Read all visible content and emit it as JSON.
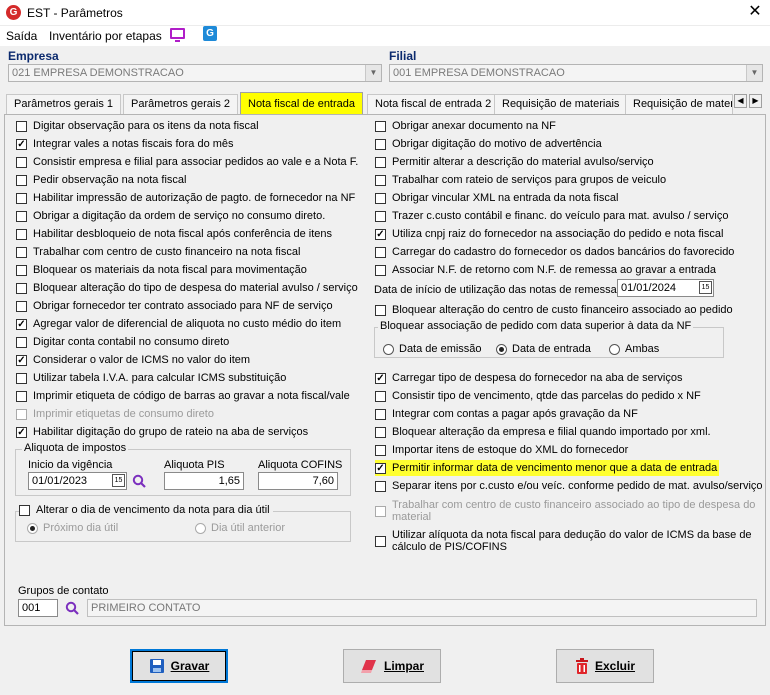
{
  "window": {
    "title": "EST - Parâmetros",
    "close": "✕"
  },
  "menu": {
    "items": [
      "Saída",
      "Inventário por etapas"
    ]
  },
  "empresa": {
    "label": "Empresa",
    "value": "021 EMPRESA DEMONSTRACAO"
  },
  "filial": {
    "label": "Filial",
    "value": "001 EMPRESA DEMONSTRACAO"
  },
  "tabs": [
    "Parâmetros gerais 1",
    "Parâmetros gerais 2",
    "Nota fiscal de entrada",
    "Nota fiscal de entrada 2",
    "Requisição de materiais",
    "Requisição de materi"
  ],
  "active_tab": "Nota fiscal de entrada",
  "left_options": [
    {
      "label": "Digitar observação para os itens da nota fiscal",
      "checked": false
    },
    {
      "label": "Integrar vales a notas fiscais fora do mês",
      "checked": true
    },
    {
      "label": "Consistir empresa e filial para associar pedidos ao vale e a Nota F.",
      "checked": false
    },
    {
      "label": "Pedir observação na nota fiscal",
      "checked": false
    },
    {
      "label": "Habilitar impressão de autorização de pagto. de fornecedor na NF",
      "checked": false
    },
    {
      "label": "Obrigar a digitação da ordem de serviço no consumo direto.",
      "checked": false
    },
    {
      "label": "Habilitar desbloqueio de nota fiscal após conferência de itens",
      "checked": false
    },
    {
      "label": "Trabalhar com centro de custo financeiro na nota fiscal",
      "checked": false
    },
    {
      "label": "Bloquear os materiais da nota fiscal para movimentação",
      "checked": false
    },
    {
      "label": "Bloquear alteração do tipo de despesa do material avulso / serviço",
      "checked": false
    },
    {
      "label": "Obrigar fornecedor ter contrato associado para NF de serviço",
      "checked": false
    },
    {
      "label": "Agregar valor de diferencial de aliquota no custo médio do item",
      "checked": true
    },
    {
      "label": "Digitar conta contabil no consumo direto",
      "checked": false
    },
    {
      "label": "Considerar o valor de ICMS no valor do item",
      "checked": true
    },
    {
      "label": "Utilizar tabela I.V.A. para calcular ICMS substituição",
      "checked": false
    },
    {
      "label": "Imprimir etiqueta de código de barras ao gravar a nota fiscal/vale",
      "checked": false
    },
    {
      "label": "Imprimir etiquetas de consumo direto",
      "checked": false,
      "disabled": true
    },
    {
      "label": "Habilitar digitação do grupo de rateio na aba de serviços",
      "checked": true
    }
  ],
  "aliquota": {
    "legend": "Aliquota de impostos",
    "inicio_label": "Inicio da vigência",
    "inicio_value": "01/01/2023",
    "pis_label": "Aliquota PIS",
    "pis_value": "1,65",
    "cofins_label": "Aliquota COFINS",
    "cofins_value": "7,60"
  },
  "vencimento": {
    "label": "Alterar o dia de vencimento da nota para dia útil",
    "options": [
      "Próximo dia útil",
      "Dia útil anterior"
    ]
  },
  "right_top": [
    {
      "label": "Obrigar anexar documento na NF",
      "checked": false
    },
    {
      "label": "Obrigar digitação do motivo de advertência",
      "checked": false
    },
    {
      "label": "Permitir alterar a descrição do material avulso/serviço",
      "checked": false
    },
    {
      "label": "Trabalhar com rateio de serviços para grupos de veiculo",
      "checked": false
    },
    {
      "label": "Obrigar vincular XML na entrada da nota fiscal",
      "checked": false
    },
    {
      "label": "Trazer c.custo contábil e financ. do veículo para mat. avulso / serviço",
      "checked": false
    },
    {
      "label": "Utiliza cnpj raiz do fornecedor na associação do pedido e nota fiscal",
      "checked": true
    },
    {
      "label": "Carregar do cadastro do fornecedor os dados bancários do favorecido",
      "checked": false
    },
    {
      "label": "Associar N.F. de retorno com N.F. de remessa ao gravar a entrada",
      "checked": false
    }
  ],
  "data_inicio": {
    "label": "Data de início de utilização das notas de remessa",
    "value": "01/01/2024"
  },
  "bloq_centro": {
    "label": "Bloquear alteração do centro de custo financeiro associado ao pedido",
    "checked": false
  },
  "bloq_assoc": {
    "legend": "Bloquear associação de pedido com data superior à data da NF",
    "options": [
      "Data de emissão",
      "Data de entrada",
      "Ambas"
    ],
    "selected": "Data de entrada"
  },
  "right_bottom": [
    {
      "label": "Carregar tipo de despesa do fornecedor na aba de serviços",
      "checked": true
    },
    {
      "label": "Consistir tipo de vencimento, qtde das parcelas do pedido x NF",
      "checked": false
    },
    {
      "label": "Integrar com contas a pagar após gravação da NF",
      "checked": false
    },
    {
      "label": "Bloquear alteração da empresa e filial quando importado por xml.",
      "checked": false
    },
    {
      "label": "Importar itens de estoque do XML do fornecedor",
      "checked": false
    },
    {
      "label": "Permitir informar data de vencimento menor que a data de entrada",
      "checked": true,
      "highlight": true
    },
    {
      "label": "Separar itens por c.custo e/ou veíc. conforme pedido de mat. avulso/serviço",
      "checked": false
    }
  ],
  "trabalhar_centro": {
    "line1": "Trabalhar com centro de custo financeiro associado ao tipo de despesa do",
    "line2": "material",
    "checked": false
  },
  "utilizar_aliquota": {
    "line1": "Utilizar alíquota da nota fiscal para dedução do valor de ICMS da base de",
    "line2": "cálculo de PIS/COFINS",
    "checked": false
  },
  "grupos": {
    "label": "Grupos de contato",
    "code": "001",
    "name": "PRIMEIRO CONTATO"
  },
  "buttons": {
    "gravar": "Gravar",
    "limpar": "Limpar",
    "excluir": "Excluir"
  },
  "colors": {
    "highlight": "#ffff00",
    "focus": "#0078d7",
    "label_blue": "#0b2a6e"
  }
}
